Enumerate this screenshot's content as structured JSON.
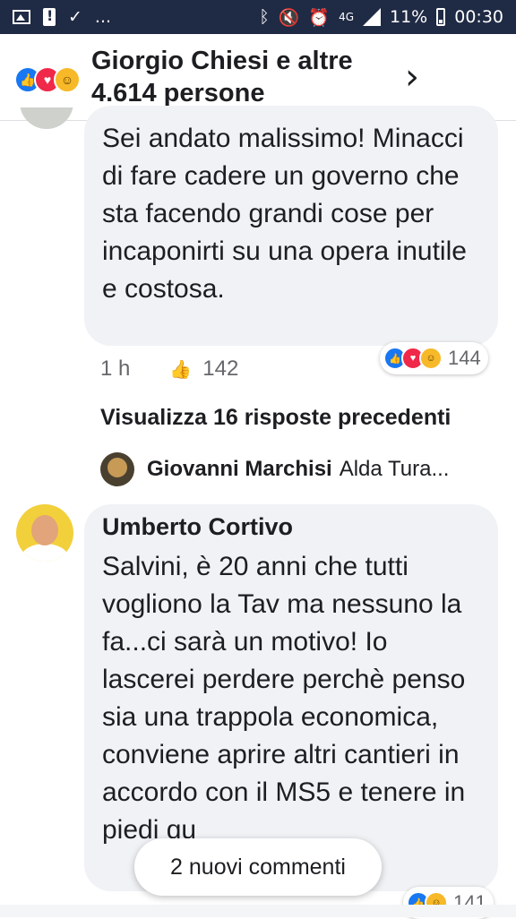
{
  "status_bar": {
    "left_more": "...",
    "network": "4G",
    "battery_pct": "11%",
    "time": "00:30"
  },
  "header": {
    "title": "Giorgio Chiesi e altre 4.614 persone",
    "reactions": [
      "like-icon",
      "love-icon",
      "haha-icon"
    ],
    "chevron": "›"
  },
  "comment1": {
    "text": "Sei andato malissimo! Minacci di fare cadere un governo che sta facendo grandi cose per incaponirti su una opera inutile e costosa.",
    "reaction_count": "144",
    "time": "1 h",
    "likes": "142"
  },
  "view_previous": "Visualizza 16 risposte precedenti",
  "reply_preview": {
    "name": "Giovanni Marchisi",
    "text": "Alda Tura..."
  },
  "comment2": {
    "author": "Umberto Cortivo",
    "text": "Salvini, è 20 anni che tutti vogliono la Tav ma nessuno la fa...ci sarà un motivo! Io lascerei perdere perchè penso sia una trappola economica, conviene aprire altri cantieri in accordo con il MS5 e tenere in piedi qu",
    "reaction_count": "141"
  },
  "new_comments_pill": "2 nuovi commenti",
  "colors": {
    "status_bar": "#1f2a44",
    "like": "#1877f2",
    "love": "#f02849",
    "haha": "#f7b928",
    "bubble": "#f0f2f5"
  }
}
